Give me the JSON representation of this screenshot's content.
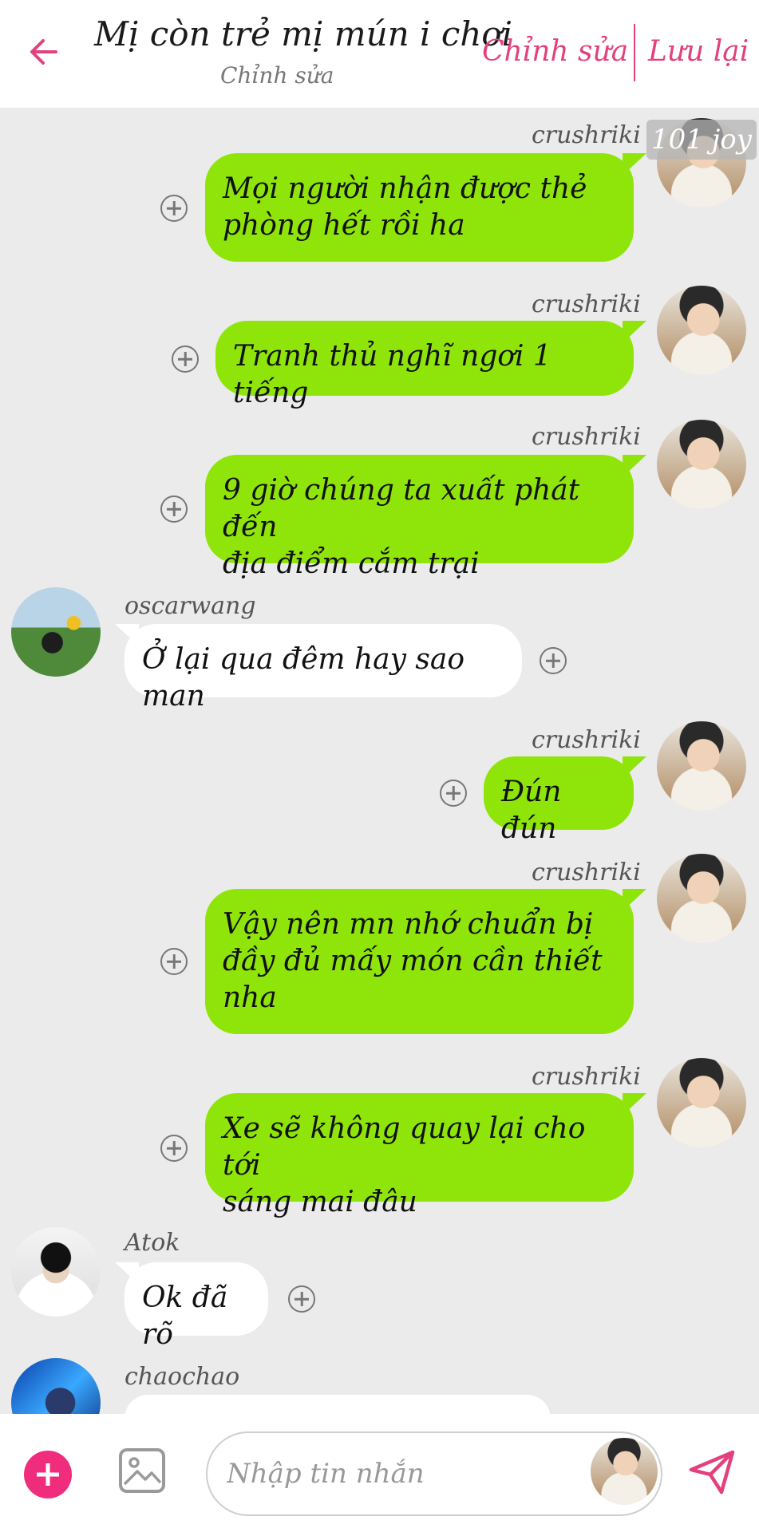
{
  "header": {
    "title": "Mị còn trẻ mị mún i chơi",
    "subtitle": "Chỉnh sửa",
    "edit_label": "Chỉnh sửa",
    "save_label": "Lưu lại",
    "back_icon": "arrow-left-icon",
    "accent_color": "#e2417e"
  },
  "tag": "101 joy",
  "messages": [
    {
      "sender": "crushriki",
      "side": "right",
      "lines": [
        "Mọi người nhận được thẻ",
        "phòng hết rồi ha"
      ]
    },
    {
      "sender": "crushriki",
      "side": "right",
      "lines": [
        "Tranh thủ nghĩ ngơi 1 tiếng"
      ]
    },
    {
      "sender": "crushriki",
      "side": "right",
      "lines": [
        "9 giờ chúng ta xuất phát đến",
        "địa điểm cắm trại"
      ]
    },
    {
      "sender": "oscarwang",
      "side": "left",
      "lines": [
        "Ở lại qua đêm hay sao man"
      ]
    },
    {
      "sender": "crushriki",
      "side": "right",
      "lines": [
        "Đún đún"
      ]
    },
    {
      "sender": "crushriki",
      "side": "right",
      "lines": [
        "Vậy nên mn nhớ chuẩn bị",
        "đầy đủ mấy món cần thiết",
        "nha"
      ]
    },
    {
      "sender": "crushriki",
      "side": "right",
      "lines": [
        "Xe sẽ không quay lại cho tới",
        "sáng mai đâu"
      ]
    },
    {
      "sender": "Atok",
      "side": "left",
      "lines": [
        "Ok đã rõ"
      ]
    },
    {
      "sender": "chaochao",
      "side": "left",
      "lines": [
        ""
      ]
    }
  ],
  "input": {
    "placeholder": "Nhập tin nhắn"
  },
  "colors": {
    "outgoing_bubble": "#8fe40a",
    "incoming_bubble": "#ffffff",
    "add_button": "#f02d7d",
    "send_icon": "#e2417e"
  }
}
